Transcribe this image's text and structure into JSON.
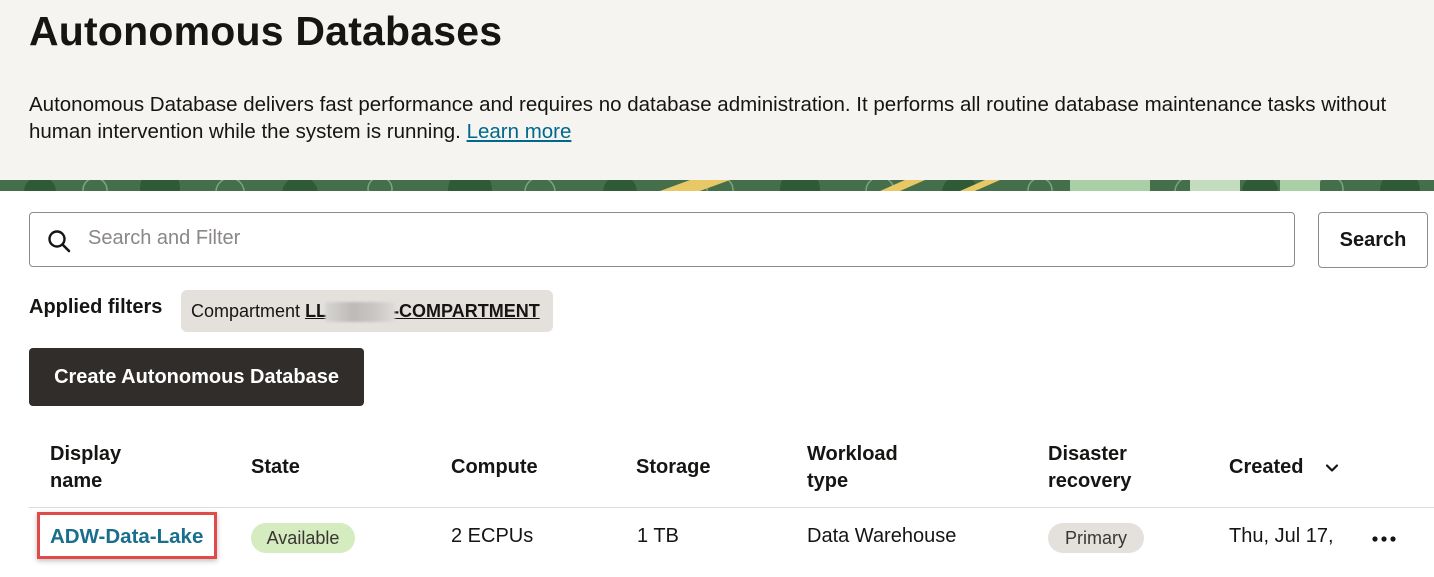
{
  "header": {
    "title": "Autonomous Databases",
    "description": "Autonomous Database delivers fast performance and requires no database administration. It performs all routine database maintenance tasks without human intervention while the system is running.",
    "learn_more": "Learn more"
  },
  "search": {
    "placeholder": "Search and Filter",
    "button_label": "Search",
    "icon": "search-icon"
  },
  "filters": {
    "label": "Applied filters",
    "chip_key": "Compartment",
    "chip_value_prefix": "LL",
    "chip_value_suffix": "-COMPARTMENT"
  },
  "actions": {
    "create_label": "Create Autonomous Database"
  },
  "table": {
    "columns": {
      "display_name": "Display name",
      "state": "State",
      "compute": "Compute",
      "storage": "Storage",
      "workload_type": "Workload type",
      "disaster_recovery": "Disaster recovery",
      "created": "Created"
    },
    "sort_icon": "chevron-down-icon",
    "rows": [
      {
        "display_name": "ADW-Data-Lake",
        "state": "Available",
        "compute": "2 ECPUs",
        "storage": "1 TB",
        "workload_type": "Data Warehouse",
        "disaster_recovery": "Primary",
        "created": "Thu, Jul 17,",
        "menu_icon": "more-actions-icon"
      }
    ]
  },
  "colors": {
    "link": "#00688c",
    "primary_button": "#312d2a",
    "state_available": "#d5ebc0",
    "highlight": "#e04a49"
  }
}
